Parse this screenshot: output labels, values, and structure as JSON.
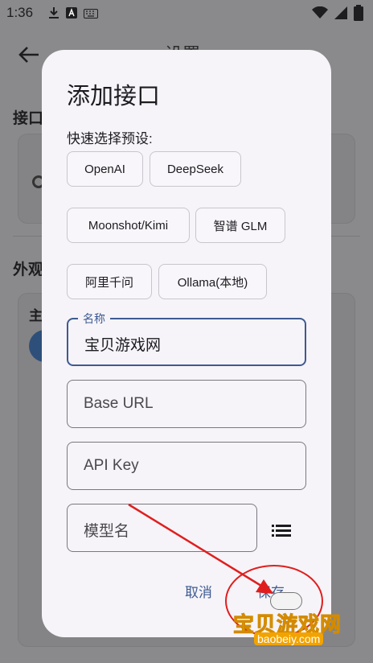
{
  "status_bar": {
    "time": "1:36"
  },
  "background": {
    "title": "设置",
    "section_interfaces": "接口",
    "section_appearance": "外观",
    "theme_label": "主"
  },
  "dialog": {
    "title": "添加接口",
    "quick_label": "快速选择预设:",
    "presets": [
      "OpenAI",
      "DeepSeek",
      "Moonshot/Kimi",
      "智谱 GLM",
      "阿里千问",
      "Ollama(本地)"
    ],
    "name_field": {
      "label": "名称",
      "value": "宝贝游戏网"
    },
    "base_url_field": {
      "placeholder": "Base URL"
    },
    "api_key_field": {
      "placeholder": "API Key"
    },
    "model_field": {
      "placeholder": "模型名"
    },
    "cancel_label": "取消",
    "save_label": "保存"
  },
  "watermark": {
    "text": "宝贝游戏网",
    "url": "baobeiy.com"
  },
  "colors": {
    "accent": "#3e5a92",
    "scrim": "#8a8a8c",
    "dialog_bg": "#f6f4f8",
    "annotation": "#e01e1e"
  }
}
